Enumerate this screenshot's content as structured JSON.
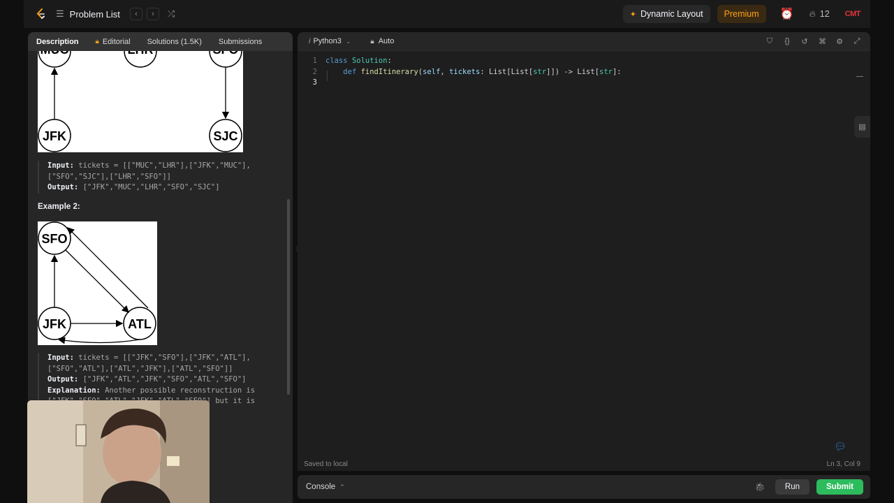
{
  "nav": {
    "problem_list": "Problem List",
    "prev_icon": "chevron-left-icon",
    "next_icon": "chevron-right-icon",
    "shuffle_icon": "shuffle-icon",
    "dynamic_layout": "Dynamic Layout",
    "premium": "Premium",
    "streak_count": "12",
    "user_badge": "CMT"
  },
  "tabs": [
    {
      "label": "Description",
      "active": true
    },
    {
      "label": "Editorial",
      "locked": true
    },
    {
      "label": "Solutions (1.5K)"
    },
    {
      "label": "Submissions"
    }
  ],
  "example1": {
    "nodes": [
      "MUC",
      "LHR",
      "SFO",
      "JFK",
      "SJC"
    ],
    "input_label": "Input:",
    "input_line1": " tickets = [[\"MUC\",\"LHR\"],[\"JFK\",\"MUC\"],",
    "input_line2": "[\"SFO\",\"SJC\"],[\"LHR\",\"SFO\"]]",
    "output_label": "Output:",
    "output_value": " [\"JFK\",\"MUC\",\"LHR\",\"SFO\",\"SJC\"]"
  },
  "example2": {
    "title": "Example 2:",
    "nodes": [
      "SFO",
      "JFK",
      "ATL"
    ],
    "input_label": "Input:",
    "input_line1": " tickets = [[\"JFK\",\"SFO\"],[\"JFK\",\"ATL\"],",
    "input_line2": "[\"SFO\",\"ATL\"],[\"ATL\",\"JFK\"],[\"ATL\",\"SFO\"]]",
    "output_label": "Output:",
    "output_value": " [\"JFK\",\"ATL\",\"JFK\",\"SFO\",\"ATL\",\"SFO\"]",
    "explanation_label": "Explanation:",
    "explanation_line1": " Another possible reconstruction is",
    "explanation_line2": "[\"JFK\",\"SFO\",\"ATL\",\"JFK\",\"ATL\",\"SFO\"] but it is"
  },
  "editor": {
    "language": "Python3",
    "mode": "Auto",
    "line_numbers": [
      "1",
      "2",
      "3"
    ],
    "saved_status": "Saved to local",
    "cursor_position": "Ln 3, Col 9"
  },
  "code": {
    "kw_class": "class",
    "cls_name": "Solution",
    "colon": ":",
    "indent": "    ",
    "kw_def": "def",
    "fn_name": "findItinerary",
    "open": "(",
    "self": "self",
    "comma": ", ",
    "param": "tickets",
    "annot_start": ": List[List[",
    "str1": "str",
    "annot_mid": "]]) -> List[",
    "str2": "str",
    "annot_end": "]:"
  },
  "console": {
    "label": "Console",
    "run": "Run",
    "submit": "Submit"
  }
}
